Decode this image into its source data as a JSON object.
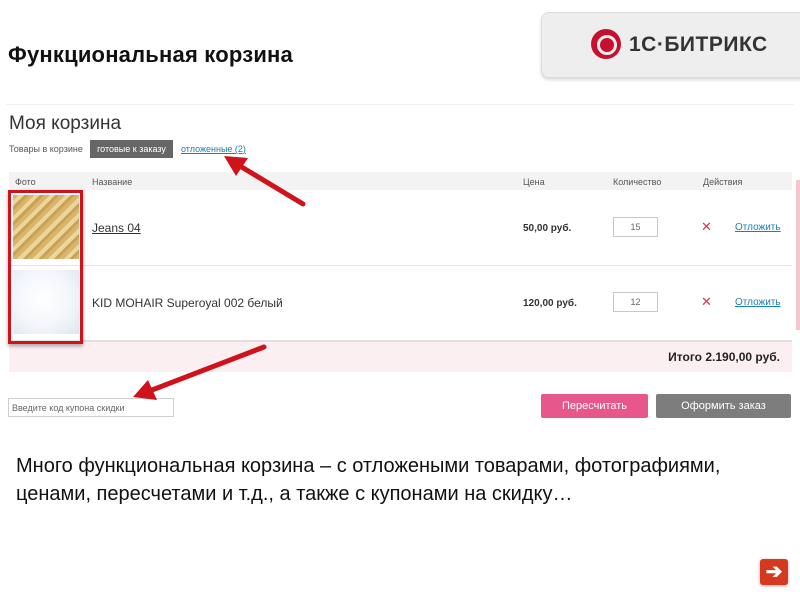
{
  "slide": {
    "title": "Функциональная корзина",
    "description": "Много функциональная корзина – с отложеными товарами, фотографиями, ценами, пересчетами и т.д., а также с купонами на скидку…",
    "next_icon": "arrow-right-icon"
  },
  "logo": {
    "text": "1С·БИТРИКС",
    "mark_icon": "bitrix-logo-icon",
    "brand_color": "#c8102e"
  },
  "cart": {
    "title": "Моя корзина",
    "tabs": {
      "label": "Товары в корзине",
      "ready": "готовые к заказу",
      "delayed": "отложенные (2)"
    },
    "columns": {
      "photo": "Фото",
      "name": "Название",
      "price": "Цена",
      "quantity": "Количество",
      "actions": "Действия"
    },
    "items": [
      {
        "name": "Jeans 04",
        "price": "50,00 руб.",
        "quantity": "15",
        "delete_icon": "close-icon",
        "postpone": "Отложить"
      },
      {
        "name": "KID MOHAIR Superoyal 002 белый",
        "price": "120,00 руб.",
        "quantity": "12",
        "delete_icon": "close-icon",
        "postpone": "Отложить"
      }
    ],
    "total": "Итого 2.190,00 руб.",
    "coupon_placeholder": "Введите код купона скидки",
    "recalc_button": "Пересчитать",
    "order_button": "Оформить заказ"
  },
  "colors": {
    "accent_pink": "#e8578b",
    "annotation_red": "#d0121b",
    "link_blue": "#1a7fb8"
  }
}
